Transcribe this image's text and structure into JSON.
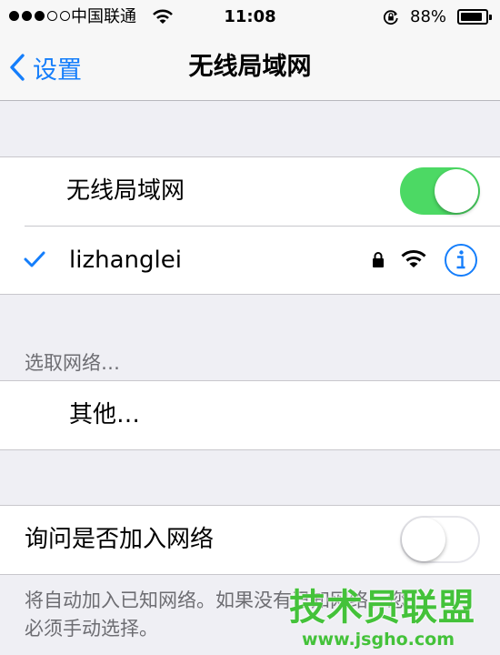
{
  "status_bar": {
    "carrier": "中国联通",
    "time": "11:08",
    "battery_percent": "88%",
    "battery_level": 0.88,
    "signal_dots_filled": 3,
    "signal_dots_total": 5
  },
  "nav": {
    "back_label": "设置",
    "title": "无线局域网"
  },
  "wifi_toggle": {
    "label": "无线局域网",
    "on": true
  },
  "current_network": {
    "name": "lizhanglei",
    "secured": true
  },
  "choose_network": {
    "header": "选取网络…",
    "other_label": "其他…"
  },
  "ask_to_join": {
    "label": "询问是否加入网络",
    "on": false,
    "footer_line1": "将自动加入已知网络。如果没有已知网络，您",
    "footer_line2": "必须手动选择。"
  },
  "watermark": {
    "title": "技术员联盟",
    "url": "www.jsgho.com"
  },
  "colors": {
    "accent": "#157efb",
    "switch_on": "#4cd964",
    "watermark": "#44c23a"
  }
}
